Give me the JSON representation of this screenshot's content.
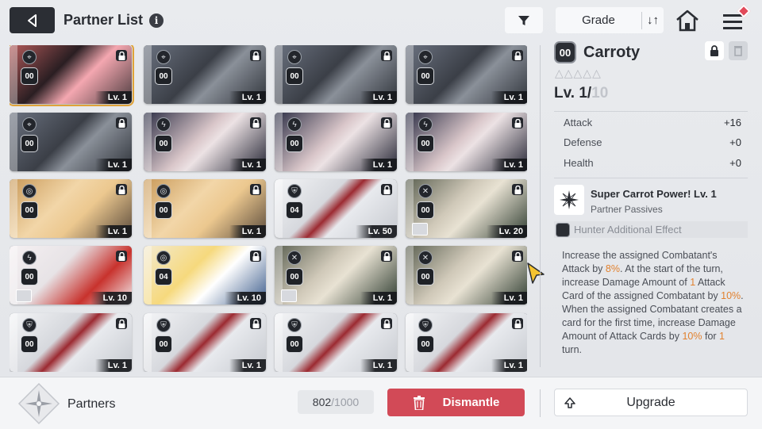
{
  "header": {
    "title": "Partner List",
    "info_icon": "i",
    "filter_icon": "filter-icon",
    "sort_label": "Grade",
    "sort_toggle": "↓↑"
  },
  "grid": {
    "cards": [
      {
        "art": "art-pink",
        "type": "⌖",
        "rank": "00",
        "level": "Lv. 1",
        "selected": true
      },
      {
        "art": "art-robot",
        "type": "⌖",
        "rank": "00",
        "level": "Lv. 1"
      },
      {
        "art": "art-robot",
        "type": "⌖",
        "rank": "00",
        "level": "Lv. 1"
      },
      {
        "art": "art-robot",
        "type": "⌖",
        "rank": "00",
        "level": "Lv. 1"
      },
      {
        "art": "art-robot",
        "type": "⌖",
        "rank": "00",
        "level": "Lv. 1"
      },
      {
        "art": "art-girl",
        "type": "ϟ",
        "rank": "00",
        "level": "Lv. 1"
      },
      {
        "art": "art-girl",
        "type": "ϟ",
        "rank": "00",
        "level": "Lv. 1"
      },
      {
        "art": "art-girl",
        "type": "ϟ",
        "rank": "00",
        "level": "Lv. 1"
      },
      {
        "art": "art-blonde",
        "type": "◎",
        "rank": "00",
        "level": "Lv. 1"
      },
      {
        "art": "art-blonde",
        "type": "◎",
        "rank": "00",
        "level": "Lv. 1"
      },
      {
        "art": "art-white",
        "type": "⛨",
        "rank": "04",
        "level": "Lv. 50"
      },
      {
        "art": "art-whale",
        "type": "✕",
        "rank": "00",
        "level": "Lv. 20",
        "avatar": true
      },
      {
        "art": "art-fox",
        "type": "ϟ",
        "rank": "00",
        "level": "Lv. 10",
        "avatar": true
      },
      {
        "art": "art-knight",
        "type": "◎",
        "rank": "04",
        "level": "Lv. 10"
      },
      {
        "art": "art-whale",
        "type": "✕",
        "rank": "00",
        "level": "Lv. 1",
        "avatar": true
      },
      {
        "art": "art-whale",
        "type": "✕",
        "rank": "00",
        "level": "Lv. 1"
      },
      {
        "art": "art-white",
        "type": "⛨",
        "rank": "00",
        "level": "Lv. 1"
      },
      {
        "art": "art-white",
        "type": "⛨",
        "rank": "00",
        "level": "Lv. 1"
      },
      {
        "art": "art-white",
        "type": "⛨",
        "rank": "00",
        "level": "Lv. 1"
      },
      {
        "art": "art-white",
        "type": "⛨",
        "rank": "00",
        "level": "Lv. 1"
      }
    ],
    "lock_glyph": "🔒"
  },
  "detail": {
    "rank": "00",
    "name": "Carroty",
    "stars": "△△△△△",
    "level_prefix": "Lv. 1/",
    "level_max": "10",
    "stats": [
      {
        "label": "Attack",
        "value": "+16"
      },
      {
        "label": "Defense",
        "value": "+0"
      },
      {
        "label": "Health",
        "value": "+0"
      }
    ],
    "passive_title": "Super Carrot Power! Lv. 1",
    "passive_sub": "Partner Passives",
    "hunter_effect": "Hunter Additional Effect",
    "desc": [
      {
        "t": "Increase the assigned Combatant's Attack by "
      },
      {
        "t": "8%",
        "hl": true
      },
      {
        "t": ". At the start of the turn, increase Damage Amount of "
      },
      {
        "t": "1",
        "hl": true
      },
      {
        "t": " Attack Card of the assigned Combatant by "
      },
      {
        "t": "10%",
        "hl": true
      },
      {
        "t": ". When the assigned Combatant creates a card for the first time, increase Damage Amount of Attack Cards by "
      },
      {
        "t": "10%",
        "hl": true
      },
      {
        "t": " for "
      },
      {
        "t": "1",
        "hl": true
      },
      {
        "t": " turn."
      }
    ]
  },
  "footer": {
    "title": "Partners",
    "count_current": "802",
    "count_sep": " / ",
    "count_total": "1000",
    "dismantle_label": "Dismantle",
    "upgrade_label": "Upgrade"
  },
  "colors": {
    "accent_selected": "#e0a338",
    "dismantle": "#d24a57",
    "highlight": "#e2812e"
  }
}
